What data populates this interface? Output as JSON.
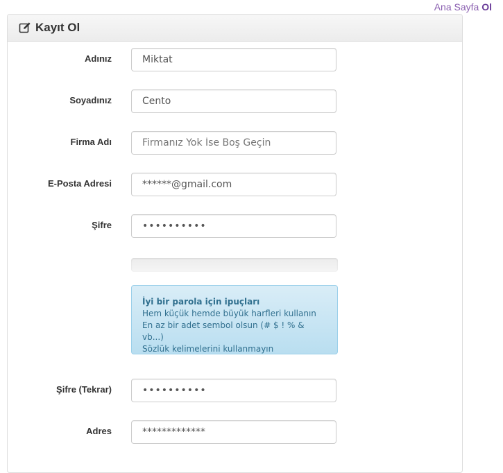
{
  "breadcrumb": {
    "home": "Ana Sayfa",
    "current": "Ol"
  },
  "panel": {
    "title": "Kayıt Ol",
    "icon": "edit-icon"
  },
  "form": {
    "first_name": {
      "label": "Adınız",
      "value": "Miktat"
    },
    "last_name": {
      "label": "Soyadınız",
      "value": "Cento"
    },
    "company": {
      "label": "Firma Adı",
      "placeholder": "Firmanız Yok İse Boş Geçin"
    },
    "email": {
      "label": "E-Posta Adresi",
      "value": "******@gmail.com"
    },
    "password": {
      "label": "Şifre",
      "value": "••••••••••"
    },
    "password_strength": 0,
    "tips": {
      "title": "İyi bir parola için ipuçları",
      "lines": [
        "Hem küçük hemde büyük harfleri kullanın",
        "En az bir adet sembol olsun (# $ ! % & vb...)",
        "Sözlük kelimelerini kullanmayın"
      ]
    },
    "password_repeat": {
      "label": "Şifre (Tekrar)",
      "value": "••••••••••"
    },
    "address": {
      "label": "Adres",
      "value": "*************"
    }
  },
  "colors": {
    "link": "#8a5fb0",
    "tips_bg": "#d9edf7",
    "tips_text": "#31708f"
  }
}
